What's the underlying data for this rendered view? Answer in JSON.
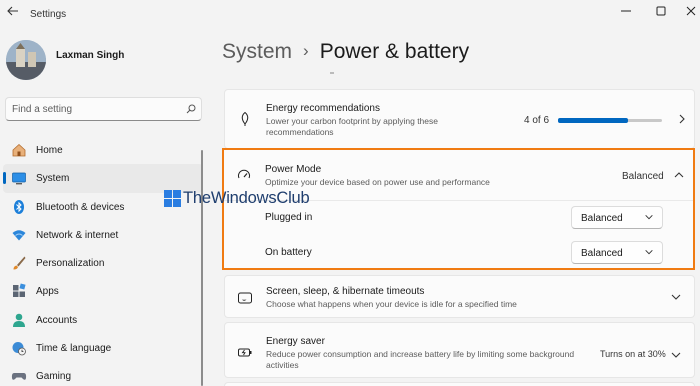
{
  "window": {
    "title": "Settings"
  },
  "profile": {
    "name": "Laxman Singh"
  },
  "search": {
    "placeholder": "Find a setting"
  },
  "sidebar": {
    "items": [
      {
        "label": "Home",
        "icon": "home-icon",
        "active": false
      },
      {
        "label": "System",
        "icon": "monitor-icon",
        "active": true
      },
      {
        "label": "Bluetooth & devices",
        "icon": "bluetooth-icon",
        "active": false
      },
      {
        "label": "Network & internet",
        "icon": "wifi-icon",
        "active": false
      },
      {
        "label": "Personalization",
        "icon": "brush-icon",
        "active": false
      },
      {
        "label": "Apps",
        "icon": "apps-icon",
        "active": false
      },
      {
        "label": "Accounts",
        "icon": "person-icon",
        "active": false
      },
      {
        "label": "Time & language",
        "icon": "globe-clock-icon",
        "active": false
      },
      {
        "label": "Gaming",
        "icon": "gamepad-icon",
        "active": false
      }
    ]
  },
  "header": {
    "parent": "System",
    "separator": "›",
    "title": "Power & battery"
  },
  "energy": {
    "title": "Energy recommendations",
    "description_line1": "Lower your carbon footprint by applying these",
    "description_line2": "recommendations",
    "progress_text": "4 of 6",
    "progress_fraction": 0.67
  },
  "power_mode": {
    "title": "Power Mode",
    "description": "Optimize your device based on power use and performance",
    "value": "Balanced",
    "plugged_in_label": "Plugged in",
    "plugged_in_value": "Balanced",
    "on_battery_label": "On battery",
    "on_battery_value": "Balanced"
  },
  "screen_sleep": {
    "title": "Screen, sleep, & hibernate timeouts",
    "description": "Choose what happens when your device is idle for a specified time"
  },
  "energy_saver": {
    "title": "Energy saver",
    "description_line1": "Reduce power consumption and increase battery life by limiting some background",
    "description_line2": "activities",
    "value": "Turns on at 30%"
  },
  "watermark": {
    "text": "TheWindowsClub"
  },
  "colors": {
    "accent": "#0067c0",
    "highlight": "#f07b12"
  }
}
